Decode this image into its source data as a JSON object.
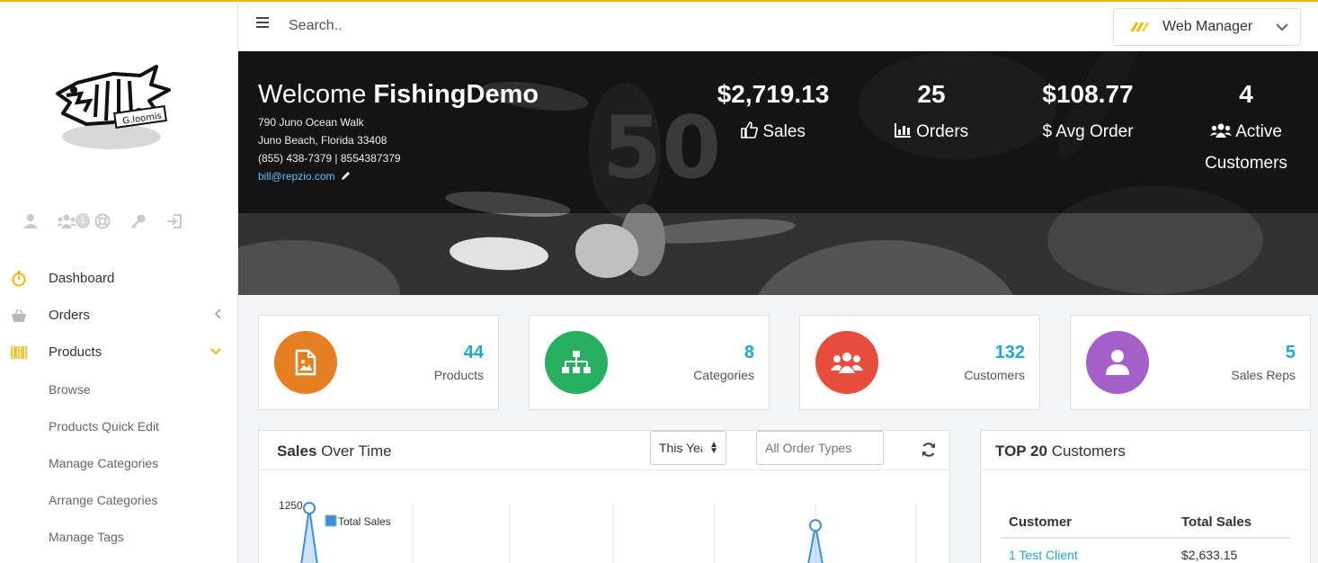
{
  "topbar": {
    "search_placeholder": "Search..",
    "account": "Web Manager"
  },
  "sidebar": {
    "notification_count": "1",
    "nav": [
      {
        "label": "Dashboard"
      },
      {
        "label": "Orders"
      },
      {
        "label": "Products"
      }
    ],
    "products_sub": [
      "Browse",
      "Products Quick Edit",
      "Manage Categories",
      "Arrange Categories",
      "Manage Tags"
    ]
  },
  "hero": {
    "welcome": "Welcome",
    "company": "FishingDemo",
    "address1": "790 Juno Ocean Walk",
    "address2": "Juno Beach, Florida 33408",
    "phone": "(855) 438-7379 | 8554387379",
    "email": "bill@repzio.com",
    "stats": [
      {
        "value": "$2,719.13",
        "label": "Sales",
        "icon": "thumbs-up-icon"
      },
      {
        "value": "25",
        "label": "Orders",
        "icon": "bar-chart-icon"
      },
      {
        "value": "$108.77",
        "label": "Avg Order",
        "icon": "dollar-icon"
      },
      {
        "value": "4",
        "label": "Active Customers",
        "icon": "users-icon"
      }
    ]
  },
  "cards": [
    {
      "value": "44",
      "label": "Products",
      "color": "#e67e22",
      "icon": "file-image-icon"
    },
    {
      "value": "8",
      "label": "Categories",
      "color": "#27ae60",
      "icon": "sitemap-icon"
    },
    {
      "value": "132",
      "label": "Customers",
      "color": "#e74c3c",
      "icon": "users-icon"
    },
    {
      "value": "5",
      "label": "Sales Reps",
      "color": "#a55fc9",
      "icon": "user-icon"
    }
  ],
  "sales_panel": {
    "title_bold": "Sales",
    "title_rest": " Over Time",
    "period": "This Year",
    "order_types_placeholder": "All Order Types",
    "y_tick": "1250",
    "legend": "Total Sales"
  },
  "chart_data": {
    "type": "line",
    "series": [
      {
        "name": "Total Sales",
        "values": [
          1250,
          null,
          null,
          null,
          null,
          1090
        ]
      }
    ],
    "ylabel": "",
    "xlabel": ""
  },
  "customers_panel": {
    "title_bold": "TOP 20",
    "title_rest": " Customers",
    "headers": [
      "Customer",
      "Total Sales"
    ],
    "rows": [
      {
        "customer": "1 Test Client",
        "total": "$2,633.15"
      }
    ]
  }
}
